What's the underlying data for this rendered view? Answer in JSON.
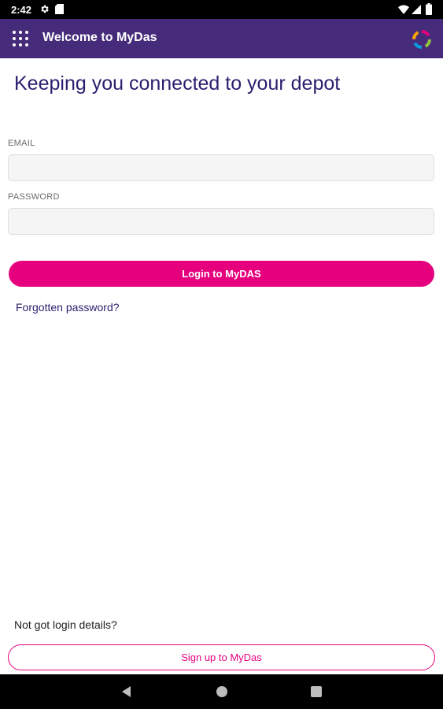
{
  "status_bar": {
    "time": "2:42",
    "icons": [
      "settings-icon",
      "sim-card-icon",
      "wifi-icon",
      "signal-icon",
      "battery-icon"
    ]
  },
  "app_bar": {
    "title": "Welcome to MyDas",
    "menu_icon": "grid-menu-icon",
    "logo_icon": "mydas-logo-icon",
    "background_color": "#452b79"
  },
  "main": {
    "headline": "Keeping you connected to your depot",
    "email": {
      "label": "EMAIL",
      "value": "",
      "placeholder": ""
    },
    "password": {
      "label": "PASSWORD",
      "value": "",
      "placeholder": ""
    },
    "login_button": "Login to MyDAS",
    "forgot_link": "Forgotten password?",
    "not_got_text": "Not got login details?",
    "signup_button": "Sign up to MyDas",
    "accent_color": "#e6007e",
    "headline_color": "#2a1f6e"
  },
  "nav_bar": {
    "buttons": [
      "back-icon",
      "home-icon",
      "recents-icon"
    ]
  }
}
